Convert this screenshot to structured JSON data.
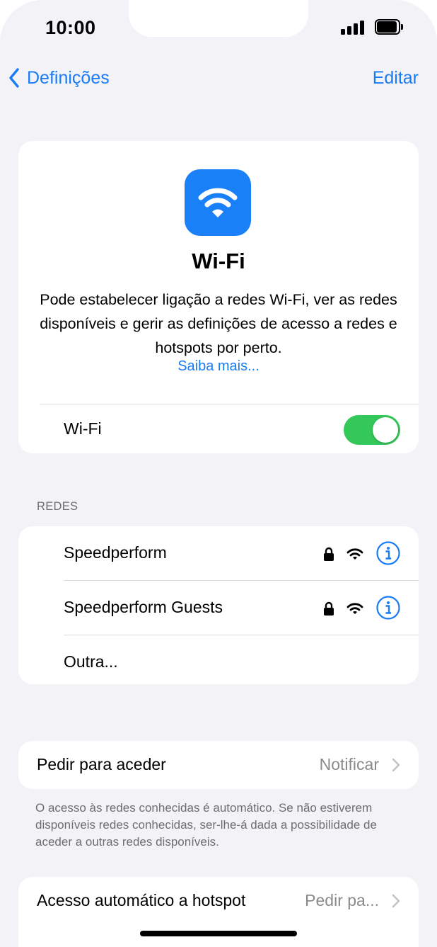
{
  "status_bar": {
    "time": "10:00"
  },
  "nav": {
    "back_label": "Definições",
    "edit_label": "Editar"
  },
  "hero": {
    "icon": "wifi-icon",
    "title": "Wi-Fi",
    "description": "Pode estabelecer ligação a redes Wi-Fi, ver as redes disponíveis e gerir as definições de acesso a redes e hotspots por perto.",
    "link": "Saiba mais..."
  },
  "wifi_toggle": {
    "label": "Wi-Fi",
    "on": true
  },
  "networks": {
    "header": "REDES",
    "items": [
      {
        "name": "Speedperform",
        "secured": true
      },
      {
        "name": "Speedperform Guests",
        "secured": true
      }
    ],
    "other_label": "Outra..."
  },
  "ask_to_join": {
    "label": "Pedir para aceder",
    "value": "Notificar",
    "footnote": "O acesso às redes conhecidas é automático. Se não estiverem disponíveis redes conhecidas, ser-lhe-á dada a possibilidade de aceder a outras redes disponíveis."
  },
  "auto_hotspot": {
    "label": "Acesso automático a hotspot",
    "value": "Pedir pa..."
  },
  "colors": {
    "accent": "#1a7cf5",
    "toggle_on": "#34c759",
    "background": "#f2f2f7"
  }
}
